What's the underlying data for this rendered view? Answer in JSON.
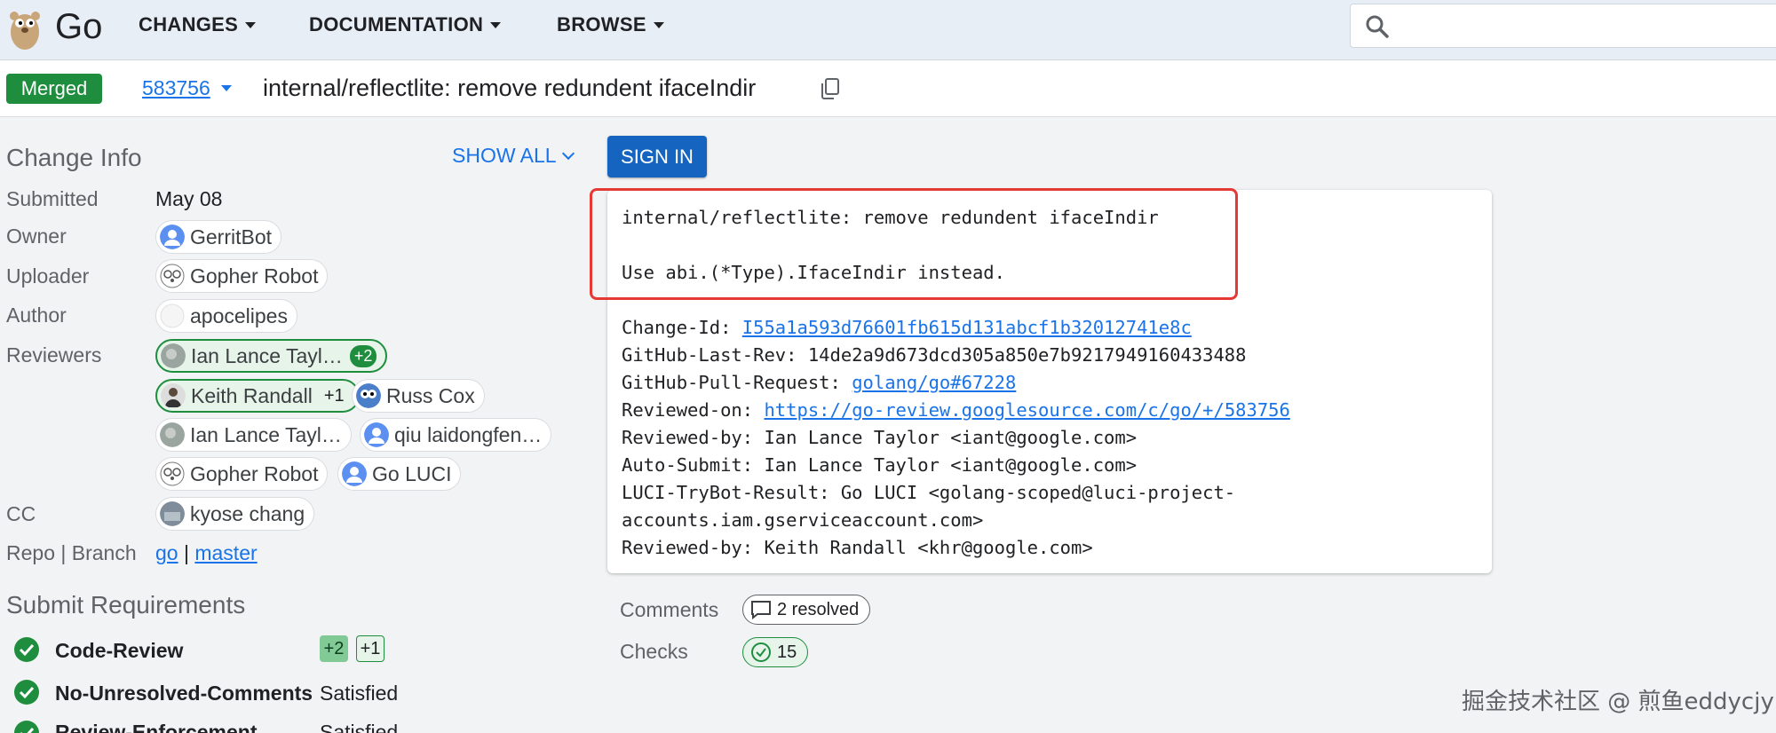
{
  "app": {
    "logo_text": "Go"
  },
  "nav": {
    "changes": "CHANGES",
    "documentation": "DOCUMENTATION",
    "browse": "BROWSE"
  },
  "search": {
    "value": ""
  },
  "header": {
    "status": "Merged",
    "change_number": "583756",
    "subject": "internal/reflectlite: remove redundent ifaceIndir"
  },
  "change_info": {
    "title": "Change Info",
    "show_all": "SHOW ALL",
    "submitted_label": "Submitted",
    "submitted_value": "May 08",
    "owner_label": "Owner",
    "owner": "GerritBot",
    "uploader_label": "Uploader",
    "uploader": "Gopher Robot",
    "author_label": "Author",
    "author": "apocelipes",
    "reviewers_label": "Reviewers",
    "reviewers": [
      {
        "name": "Ian Lance Tayl…",
        "vote": "+2"
      },
      {
        "name": "Keith Randall",
        "vote": "+1"
      },
      {
        "name": "Russ Cox",
        "vote": ""
      },
      {
        "name": "Ian Lance Tayl…",
        "vote": ""
      },
      {
        "name": "qiu laidongfen…",
        "vote": ""
      },
      {
        "name": "Gopher Robot",
        "vote": ""
      },
      {
        "name": "Go LUCI",
        "vote": ""
      }
    ],
    "cc_label": "CC",
    "cc": "kyose chang",
    "repo_branch_label": "Repo | Branch",
    "repo": "go",
    "separator": "|",
    "branch": "master"
  },
  "submit_requirements": {
    "title": "Submit Requirements",
    "items": [
      {
        "name": "Code-Review",
        "status": "",
        "votes": [
          "+2",
          "+1"
        ]
      },
      {
        "name": "No-Unresolved-Comments",
        "status": "Satisfied"
      },
      {
        "name": "Review-Enforcement",
        "status": "Satisfied"
      }
    ]
  },
  "sign_in": "SIGN IN",
  "commit_message": {
    "subject_line": "internal/reflectlite: remove redundent ifaceIndir",
    "body_line": "Use abi.(*Type).IfaceIndir instead.",
    "change_id_label": "Change-Id: ",
    "change_id": "I55a1a593d76601fb615d131abcf1b32012741e8c",
    "github_rev": "GitHub-Last-Rev: 14de2a9d673dcd305a850e7b9217949160433488",
    "github_pr_label": "GitHub-Pull-Request: ",
    "github_pr": "golang/go#67228",
    "reviewed_on_label": "Reviewed-on: ",
    "reviewed_on": "https://go-review.googlesource.com/c/go/+/583756",
    "reviewed_by_1": "Reviewed-by: Ian Lance Taylor <iant@google.com>",
    "auto_submit": "Auto-Submit: Ian Lance Taylor <iant@google.com>",
    "luci_1": "LUCI-TryBot-Result: Go LUCI <golang-scoped@luci-project-",
    "luci_2": "accounts.iam.gserviceaccount.com>",
    "reviewed_by_2": "Reviewed-by: Keith Randall <khr@google.com>"
  },
  "meta": {
    "comments_label": "Comments",
    "comments_value": "2 resolved",
    "checks_label": "Checks",
    "checks_value": "15"
  },
  "watermark": "掘金技术社区 @ 煎鱼eddycjy",
  "colors": {
    "accent": "#1a73e8",
    "merged": "#1e8e3e",
    "highlight": "#e53935",
    "sign_in": "#1565c0"
  }
}
